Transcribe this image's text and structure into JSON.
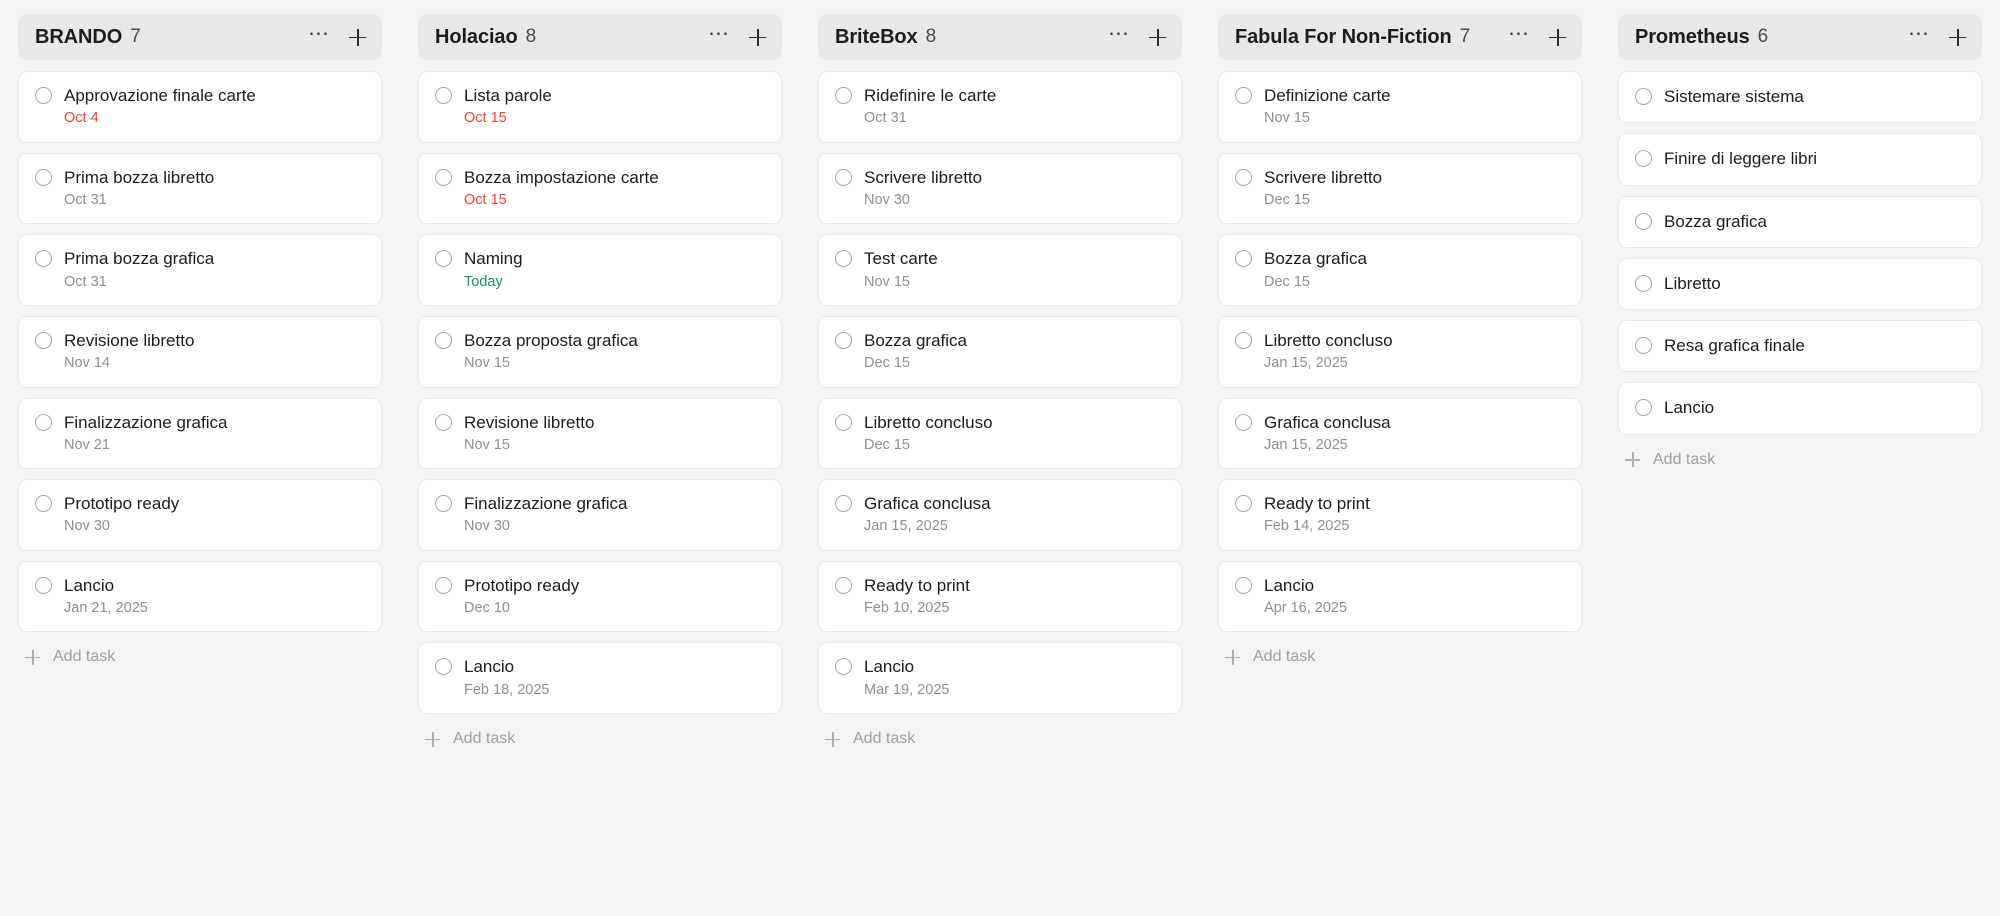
{
  "board": {
    "background_color": "#f4f4f4",
    "header_color": "#e8e8e8",
    "card_color": "#ffffff",
    "overdue_color": "#fb3b30",
    "today_color": "#12985c",
    "date_color": "#8e8e93",
    "add_task_label": "Add task"
  },
  "columns": [
    {
      "title": "BRANDO",
      "count": "7",
      "add_task_label": "Add task",
      "tasks": [
        {
          "title": "Approvazione finale carte",
          "date": "Oct 4",
          "state": "overdue"
        },
        {
          "title": "Prima bozza libretto",
          "date": "Oct 31",
          "state": "normal"
        },
        {
          "title": "Prima bozza grafica",
          "date": "Oct 31",
          "state": "normal"
        },
        {
          "title": "Revisione libretto",
          "date": "Nov 14",
          "state": "normal"
        },
        {
          "title": "Finalizzazione grafica",
          "date": "Nov 21",
          "state": "normal"
        },
        {
          "title": "Prototipo ready",
          "date": "Nov 30",
          "state": "normal"
        },
        {
          "title": "Lancio",
          "date": "Jan 21, 2025",
          "state": "normal"
        }
      ]
    },
    {
      "title": "Holaciao",
      "count": "8",
      "add_task_label": "Add task",
      "tasks": [
        {
          "title": "Lista parole",
          "date": "Oct 15",
          "state": "overdue"
        },
        {
          "title": "Bozza impostazione carte",
          "date": "Oct 15",
          "state": "overdue"
        },
        {
          "title": "Naming",
          "date": "Today",
          "state": "today"
        },
        {
          "title": "Bozza proposta grafica",
          "date": "Nov 15",
          "state": "normal"
        },
        {
          "title": "Revisione libretto",
          "date": "Nov 15",
          "state": "normal"
        },
        {
          "title": "Finalizzazione grafica",
          "date": "Nov 30",
          "state": "normal"
        },
        {
          "title": "Prototipo ready",
          "date": "Dec 10",
          "state": "normal"
        },
        {
          "title": "Lancio",
          "date": "Feb 18, 2025",
          "state": "normal"
        }
      ]
    },
    {
      "title": "BriteBox",
      "count": "8",
      "add_task_label": "Add task",
      "tasks": [
        {
          "title": "Ridefinire le carte",
          "date": "Oct 31",
          "state": "normal"
        },
        {
          "title": "Scrivere libretto",
          "date": "Nov 30",
          "state": "normal"
        },
        {
          "title": "Test carte",
          "date": "Nov 15",
          "state": "normal"
        },
        {
          "title": "Bozza grafica",
          "date": "Dec 15",
          "state": "normal"
        },
        {
          "title": "Libretto concluso",
          "date": "Dec 15",
          "state": "normal"
        },
        {
          "title": "Grafica conclusa",
          "date": "Jan 15, 2025",
          "state": "normal"
        },
        {
          "title": "Ready to print",
          "date": "Feb 10, 2025",
          "state": "normal"
        },
        {
          "title": "Lancio",
          "date": "Mar 19, 2025",
          "state": "normal"
        }
      ]
    },
    {
      "title": "Fabula For Non-Fiction",
      "count": "7",
      "add_task_label": "Add task",
      "tasks": [
        {
          "title": "Definizione carte",
          "date": "Nov 15",
          "state": "normal"
        },
        {
          "title": "Scrivere libretto",
          "date": "Dec 15",
          "state": "normal"
        },
        {
          "title": "Bozza grafica",
          "date": "Dec 15",
          "state": "normal"
        },
        {
          "title": "Libretto concluso",
          "date": "Jan 15, 2025",
          "state": "normal"
        },
        {
          "title": "Grafica conclusa",
          "date": "Jan 15, 2025",
          "state": "normal"
        },
        {
          "title": "Ready to print",
          "date": "Feb 14, 2025",
          "state": "normal"
        },
        {
          "title": "Lancio",
          "date": "Apr 16, 2025",
          "state": "normal"
        }
      ]
    },
    {
      "title": "Prometheus",
      "count": "6",
      "add_task_label": "Add task",
      "tasks": [
        {
          "title": "Sistemare sistema",
          "date": "",
          "state": "none"
        },
        {
          "title": "Finire di leggere libri",
          "date": "",
          "state": "none"
        },
        {
          "title": "Bozza grafica",
          "date": "",
          "state": "none"
        },
        {
          "title": "Libretto",
          "date": "",
          "state": "none"
        },
        {
          "title": "Resa grafica finale",
          "date": "",
          "state": "none"
        },
        {
          "title": "Lancio",
          "date": "",
          "state": "none"
        }
      ]
    }
  ]
}
